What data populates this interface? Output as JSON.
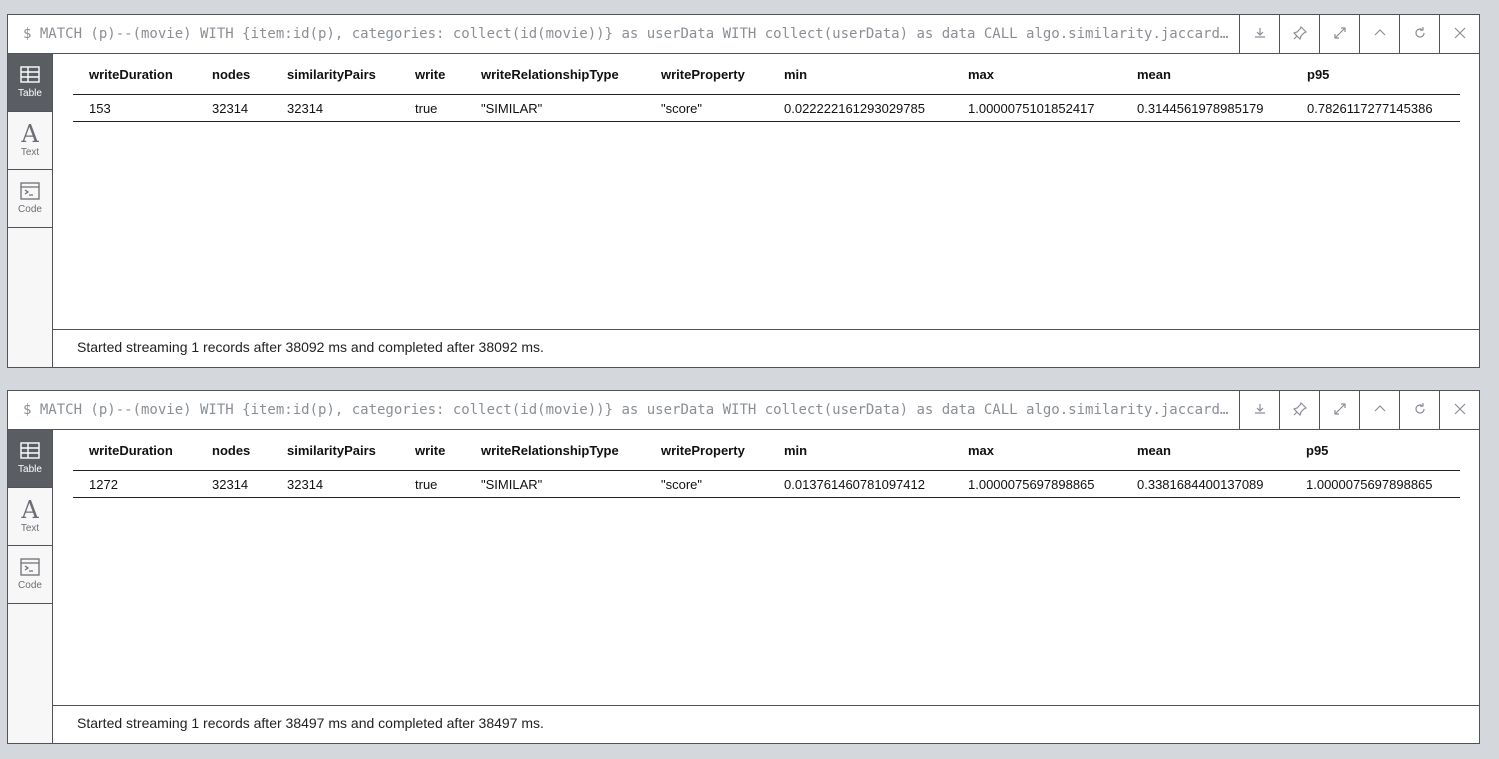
{
  "frames": [
    {
      "query": "$ MATCH (p)--(movie) WITH {item:id(p), categories: collect(id(movie))} as userData WITH collect(userData) as data CALL algo.similarity.jaccard(data, {top...",
      "columns": [
        "writeDuration",
        "nodes",
        "similarityPairs",
        "write",
        "writeRelationshipType",
        "writeProperty",
        "min",
        "max",
        "mean",
        "p95"
      ],
      "row": [
        "153",
        "32314",
        "32314",
        "true",
        "\"SIMILAR\"",
        "\"score\"",
        "0.022222161293029785",
        "1.0000075101852417",
        "0.3144561978985179",
        "0.7826117277145386"
      ],
      "status": "Started streaming 1 records after 38092 ms and completed after 38092 ms."
    },
    {
      "query": "$ MATCH (p)--(movie) WITH {item:id(p), categories: collect(id(movie))} as userData WITH collect(userData) as data CALL algo.similarity.jaccard(data, {top...",
      "columns": [
        "writeDuration",
        "nodes",
        "similarityPairs",
        "write",
        "writeRelationshipType",
        "writeProperty",
        "min",
        "max",
        "mean",
        "p95"
      ],
      "row": [
        "1272",
        "32314",
        "32314",
        "true",
        "\"SIMILAR\"",
        "\"score\"",
        "0.013761460781097412",
        "1.0000075697898865",
        "0.3381684400137089",
        "1.0000075697898865"
      ],
      "status": "Started streaming 1 records after 38497 ms and completed after 38497 ms."
    }
  ],
  "sidebar": {
    "table_label": "Table",
    "text_label": "Text",
    "code_label": "Code"
  },
  "icons": [
    "download-icon",
    "pin-icon",
    "expand-icon",
    "collapse-icon",
    "rerun-icon",
    "close-icon",
    "table-icon",
    "text-icon",
    "code-icon"
  ]
}
